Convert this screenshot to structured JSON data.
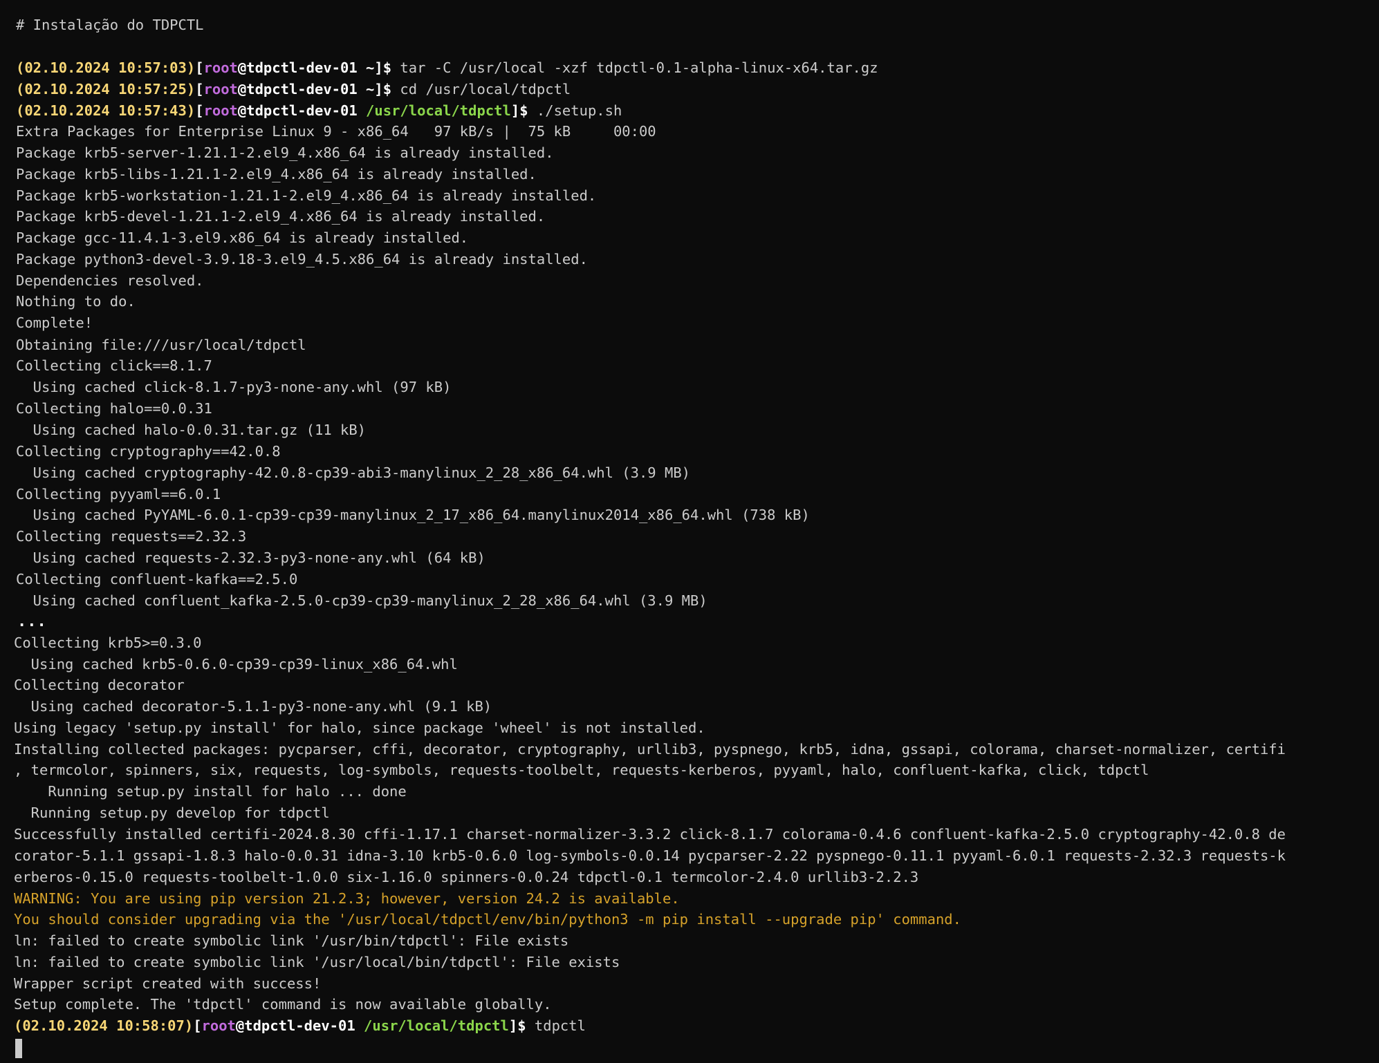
{
  "terminal": {
    "heading": "# Instalação do TDPCTL",
    "prompts": [
      {
        "timestamp": "(02.10.2024 10:57:03)",
        "open": "[",
        "user": "root",
        "at_host": "@tdpctl-dev-01",
        "path": "~",
        "close": "]$",
        "command": " tar -C /usr/local -xzf tdpctl-0.1-alpha-linux-x64.tar.gz"
      },
      {
        "timestamp": "(02.10.2024 10:57:25)",
        "open": "[",
        "user": "root",
        "at_host": "@tdpctl-dev-01",
        "path": "~",
        "close": "]$",
        "command": " cd /usr/local/tdpctl"
      },
      {
        "timestamp": "(02.10.2024 10:57:43)",
        "open": "[",
        "user": "root",
        "at_host": "@tdpctl-dev-01",
        "path": "/usr/local/tdpctl",
        "close": "]$",
        "command": " ./setup.sh"
      },
      {
        "timestamp": "(02.10.2024 10:58:07)",
        "open": "[",
        "user": "root",
        "at_host": "@tdpctl-dev-01",
        "path": "/usr/local/tdpctl",
        "close": "]$",
        "command": " tdpctl"
      }
    ],
    "output_top": [
      "Extra Packages for Enterprise Linux 9 - x86_64   97 kB/s |  75 kB     00:00",
      "Package krb5-server-1.21.1-2.el9_4.x86_64 is already installed.",
      "Package krb5-libs-1.21.1-2.el9_4.x86_64 is already installed.",
      "Package krb5-workstation-1.21.1-2.el9_4.x86_64 is already installed.",
      "Package krb5-devel-1.21.1-2.el9_4.x86_64 is already installed.",
      "Package gcc-11.4.1-3.el9.x86_64 is already installed.",
      "Package python3-devel-3.9.18-3.el9_4.5.x86_64 is already installed.",
      "Dependencies resolved.",
      "Nothing to do.",
      "Complete!",
      "Obtaining file:///usr/local/tdpctl",
      "Collecting click==8.1.7",
      "  Using cached click-8.1.7-py3-none-any.whl (97 kB)",
      "Collecting halo==0.0.31",
      "  Using cached halo-0.0.31.tar.gz (11 kB)",
      "Collecting cryptography==42.0.8",
      "  Using cached cryptography-42.0.8-cp39-abi3-manylinux_2_28_x86_64.whl (3.9 MB)",
      "Collecting pyyaml==6.0.1",
      "  Using cached PyYAML-6.0.1-cp39-cp39-manylinux_2_17_x86_64.manylinux2014_x86_64.whl (738 kB)",
      "Collecting requests==2.32.3",
      "  Using cached requests-2.32.3-py3-none-any.whl (64 kB)",
      "Collecting confluent-kafka==2.5.0",
      "  Using cached confluent_kafka-2.5.0-cp39-cp39-manylinux_2_28_x86_64.whl (3.9 MB)"
    ],
    "ellipsis": "...",
    "output_bottom": [
      "Collecting krb5>=0.3.0",
      "  Using cached krb5-0.6.0-cp39-cp39-linux_x86_64.whl",
      "Collecting decorator",
      "  Using cached decorator-5.1.1-py3-none-any.whl (9.1 kB)",
      "Using legacy 'setup.py install' for halo, since package 'wheel' is not installed.",
      "Installing collected packages: pycparser, cffi, decorator, cryptography, urllib3, pyspnego, krb5, idna, gssapi, colorama, charset-normalizer, certifi",
      ", termcolor, spinners, six, requests, log-symbols, requests-toolbelt, requests-kerberos, pyyaml, halo, confluent-kafka, click, tdpctl",
      "    Running setup.py install for halo ... done",
      "  Running setup.py develop for tdpctl",
      "Successfully installed certifi-2024.8.30 cffi-1.17.1 charset-normalizer-3.3.2 click-8.1.7 colorama-0.4.6 confluent-kafka-2.5.0 cryptography-42.0.8 de",
      "corator-5.1.1 gssapi-1.8.3 halo-0.0.31 idna-3.10 krb5-0.6.0 log-symbols-0.0.14 pycparser-2.22 pyspnego-0.11.1 pyyaml-6.0.1 requests-2.32.3 requests-k",
      "erberos-0.15.0 requests-toolbelt-1.0.0 six-1.16.0 spinners-0.0.24 tdpctl-0.1 termcolor-2.4.0 urllib3-2.2.3"
    ],
    "warnings": [
      "WARNING: You are using pip version 21.2.3; however, version 24.2 is available.",
      "You should consider upgrading via the '/usr/local/tdpctl/env/bin/python3 -m pip install --upgrade pip' command."
    ],
    "output_end": [
      "ln: failed to create symbolic link '/usr/bin/tdpctl': File exists",
      "ln: failed to create symbolic link '/usr/local/bin/tdpctl': File exists",
      "Wrapper script created with success!",
      "Setup complete. The 'tdpctl' command is now available globally."
    ],
    "colors": {
      "background": "#0c0c0c",
      "text": "#cccccc",
      "timestamp": "#f9d776",
      "user": "#c16bdc",
      "path": "#8bd64b",
      "warning": "#d6a22a"
    }
  }
}
